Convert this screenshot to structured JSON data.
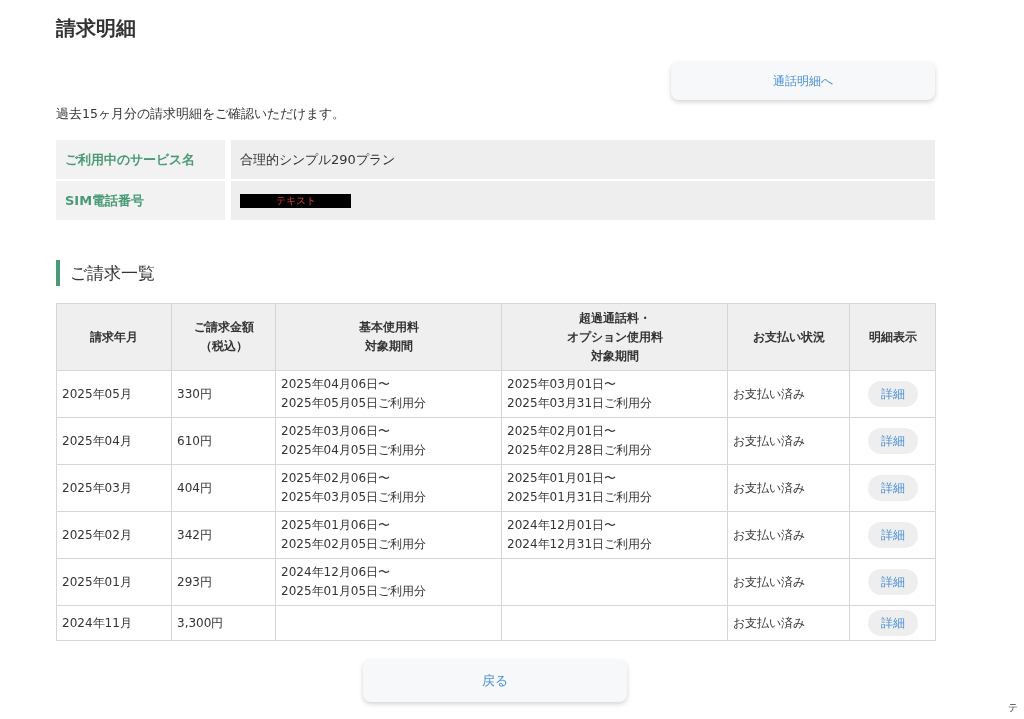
{
  "title": "請求明細",
  "call_details_button": "通話明細へ",
  "description": "過去15ヶ月分の請求明細をご確認いただけます。",
  "info": [
    {
      "label": "ご利用中のサービス名",
      "value": "合理的シンプル290プラン",
      "kind": "text"
    },
    {
      "label": "SIM電話番号",
      "value": "テキスト",
      "kind": "redacted"
    }
  ],
  "section_title": "ご請求一覧",
  "table": {
    "columns": [
      [
        "請求年月"
      ],
      [
        "ご請求金額",
        "（税込）"
      ],
      [
        "基本使用料",
        "対象期間"
      ],
      [
        "超過通話料・",
        "オプション使用料",
        "対象期間"
      ],
      [
        "お支払い状況"
      ],
      [
        "明細表示"
      ]
    ],
    "rows": [
      {
        "month": "2025年05月",
        "amount": "330円",
        "basic_period": "2025年04月06日〜\n2025年05月05日ご利用分",
        "extra_period": "2025年03月01日〜\n2025年03月31日ご利用分",
        "status": "お支払い済み",
        "detail": "詳細"
      },
      {
        "month": "2025年04月",
        "amount": "610円",
        "basic_period": "2025年03月06日〜\n2025年04月05日ご利用分",
        "extra_period": "2025年02月01日〜\n2025年02月28日ご利用分",
        "status": "お支払い済み",
        "detail": "詳細"
      },
      {
        "month": "2025年03月",
        "amount": "404円",
        "basic_period": "2025年02月06日〜\n2025年03月05日ご利用分",
        "extra_period": "2025年01月01日〜\n2025年01月31日ご利用分",
        "status": "お支払い済み",
        "detail": "詳細"
      },
      {
        "month": "2025年02月",
        "amount": "342円",
        "basic_period": "2025年01月06日〜\n2025年02月05日ご利用分",
        "extra_period": "2024年12月01日〜\n2024年12月31日ご利用分",
        "status": "お支払い済み",
        "detail": "詳細"
      },
      {
        "month": "2025年01月",
        "amount": "293円",
        "basic_period": "2024年12月06日〜\n2025年01月05日ご利用分",
        "status": "お支払い済み",
        "detail": "詳細"
      },
      {
        "month": "2024年11月",
        "amount": "3,300円",
        "status": "お支払い済み",
        "detail": "詳細"
      }
    ]
  },
  "back_button": "戻る",
  "corner_text": "テ"
}
